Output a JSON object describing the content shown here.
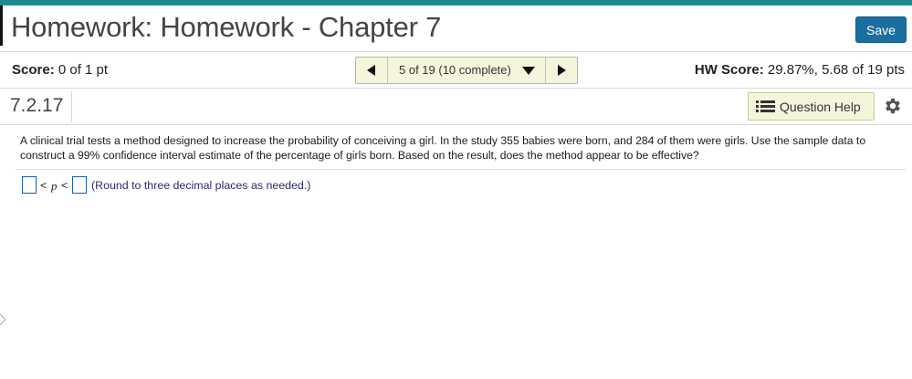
{
  "header": {
    "title": "Homework: Homework - Chapter 7",
    "save_label": "Save"
  },
  "score_bar": {
    "score_label": "Score:",
    "score_value": "0 of 1 pt",
    "nav_position": "5 of 19 (10 complete)",
    "hw_score_label": "HW Score:",
    "hw_score_value": "29.87%, 5.68 of 19 pts"
  },
  "question": {
    "number": "7.2.17",
    "help_label": "Question Help",
    "text": "A clinical trial tests a method designed to increase the probability of conceiving a girl. In the study 355 babies were born, and 284 of them were girls. Use the sample data to construct a 99% confidence interval estimate of the percentage of girls born. Based on the result, does the method appear to be effective?",
    "answer": {
      "lower_value": "",
      "upper_value": "",
      "lt_symbol": "<",
      "variable": "p",
      "hint": "(Round to three decimal places as needed.)"
    }
  },
  "colors": {
    "accent_teal": "#1f8a8f",
    "save_blue": "#1a6fa0",
    "nav_bg": "#f5f5dc",
    "answer_box_border": "#1a5fa8"
  },
  "icons": {
    "prev": "triangle-left-icon",
    "next": "triangle-right-icon",
    "dropdown": "triangle-down-icon",
    "help": "list-icon",
    "settings": "gear-icon"
  }
}
